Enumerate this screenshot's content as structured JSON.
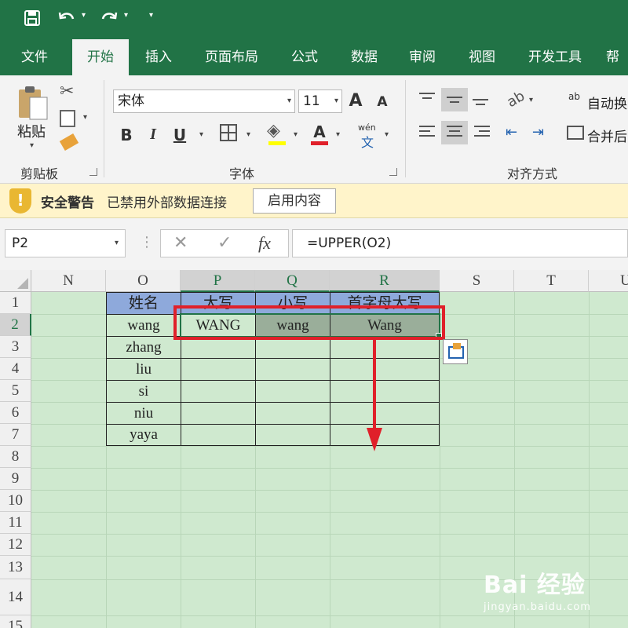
{
  "ribbon": {
    "tabs": [
      "文件",
      "开始",
      "插入",
      "页面布局",
      "公式",
      "数据",
      "审阅",
      "视图",
      "开发工具",
      "帮"
    ],
    "active_tab": "开始",
    "clipboard": {
      "paste_label": "粘贴",
      "group_label": "剪贴板"
    },
    "font": {
      "name": "宋体",
      "size": "11",
      "group_label": "字体",
      "bold": "B",
      "italic": "I",
      "underline": "U",
      "grow": "A",
      "shrink": "A",
      "pinyin_top": "wén",
      "pinyin_bottom": "文",
      "font_color": "A"
    },
    "alignment": {
      "wrap_label": "自动换",
      "merge_label": "合并后",
      "group_label": "对齐方式",
      "wrap_icon_text": "ab"
    },
    "colors": {
      "brand": "#217346",
      "font_color_bar": "#e0202a",
      "fill_color_bar": "#ffff00"
    }
  },
  "security": {
    "title": "安全警告",
    "message": "已禁用外部数据连接",
    "button": "启用内容"
  },
  "formula_bar": {
    "name_box": "P2",
    "formula": "=UPPER(O2)",
    "fx": "fx"
  },
  "grid": {
    "columns": [
      "N",
      "O",
      "P",
      "Q",
      "R",
      "S",
      "T",
      "U"
    ],
    "selected_columns": [
      "P",
      "Q",
      "R"
    ],
    "rows": [
      "1",
      "2",
      "3",
      "4",
      "5",
      "6",
      "7",
      "8",
      "9",
      "10",
      "11",
      "12",
      "13",
      "14",
      "15"
    ],
    "selected_row": "2",
    "headers": [
      "姓名",
      "大写",
      "小写",
      "首字母大写"
    ],
    "names": [
      "wang",
      "zhang",
      "liu",
      "si",
      "niu",
      "yaya"
    ],
    "row2_results": [
      "WANG",
      "wang",
      "Wang"
    ],
    "sheet_bg": "#cfe9cf",
    "header_fill": "#8ea9db",
    "highlight": "#e0202a"
  },
  "watermark": {
    "main": "Bai 经验",
    "sub": "jingyan.baidu.com"
  }
}
